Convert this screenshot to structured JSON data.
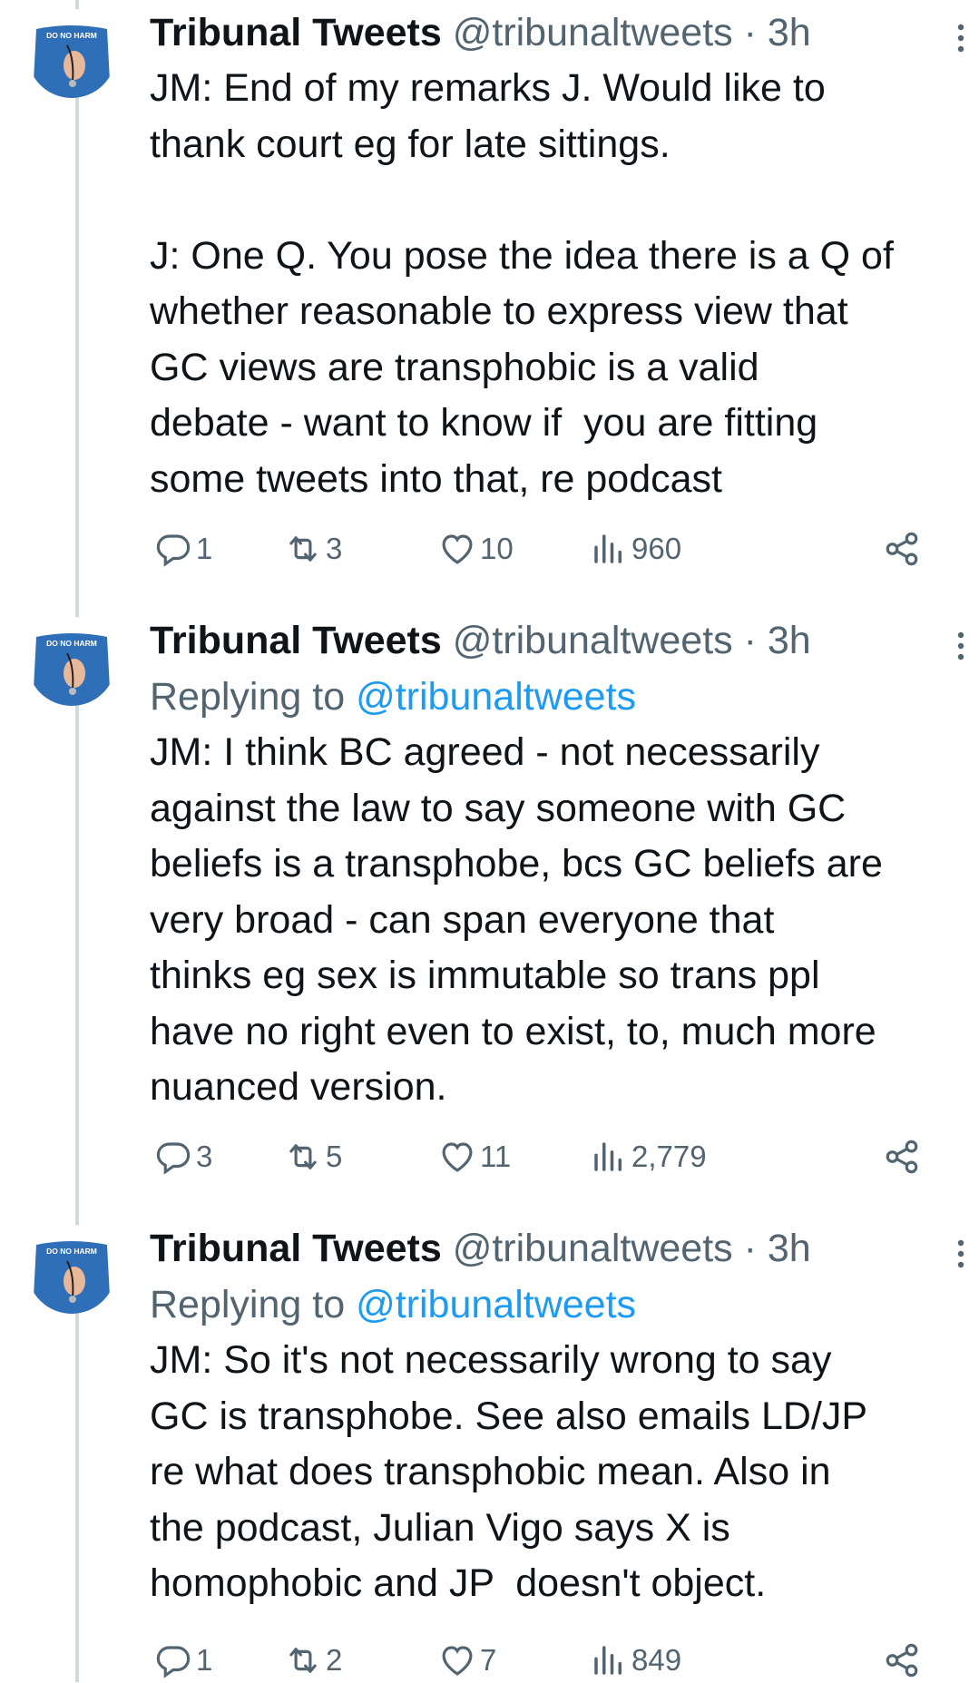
{
  "tweets": [
    {
      "avatar_text": "DO NO HARM",
      "display_name": "Tribunal Tweets",
      "handle_time": " @tribunaltweets · 3h",
      "replying_prefix": "",
      "replying_handle": "",
      "text": "JM: End of my remarks J. Would like to\nthank court eg for late sittings.\n\nJ: One Q. You pose the idea there is a Q of\nwhether reasonable to express view that\nGC views are transphobic is a valid\ndebate - want to know if  you are fitting\nsome tweets into that, re podcast",
      "replies": "1",
      "retweets": "3",
      "likes": "10",
      "views": "960"
    },
    {
      "avatar_text": "DO NO HARM",
      "display_name": "Tribunal Tweets",
      "handle_time": " @tribunaltweets · 3h",
      "replying_prefix": "Replying to ",
      "replying_handle": "@tribunaltweets",
      "text": "JM: I think BC agreed - not necessarily\nagainst the law to say someone with GC\nbeliefs is a transphobe, bcs GC beliefs are\nvery broad - can span everyone that\nthinks eg sex is immutable so trans ppl\nhave no right even to exist, to, much more\nnuanced version.",
      "replies": "3",
      "retweets": "5",
      "likes": "11",
      "views": "2,779"
    },
    {
      "avatar_text": "DO NO HARM",
      "display_name": "Tribunal Tweets",
      "handle_time": " @tribunaltweets · 3h",
      "replying_prefix": "Replying to ",
      "replying_handle": "@tribunaltweets",
      "text": "JM: So it's not necessarily wrong to say\nGC is transphobe. See also emails LD/JP\nre what does transphobic mean. Also in\nthe podcast, Julian Vigo says X is\nhomophobic and JP  doesn't object.",
      "replies": "1",
      "retweets": "2",
      "likes": "7",
      "views": "849"
    }
  ],
  "icons": {
    "reply": "reply-icon",
    "retweet": "retweet-icon",
    "like": "heart-icon",
    "views": "views-icon",
    "share": "share-icon",
    "more": "more-options-icon"
  },
  "colors": {
    "text": "#0f1419",
    "secondary": "#536471",
    "link": "#1d9bf0",
    "thread_line": "#cfd9de",
    "avatar_shirt": "#2f6fb7"
  }
}
